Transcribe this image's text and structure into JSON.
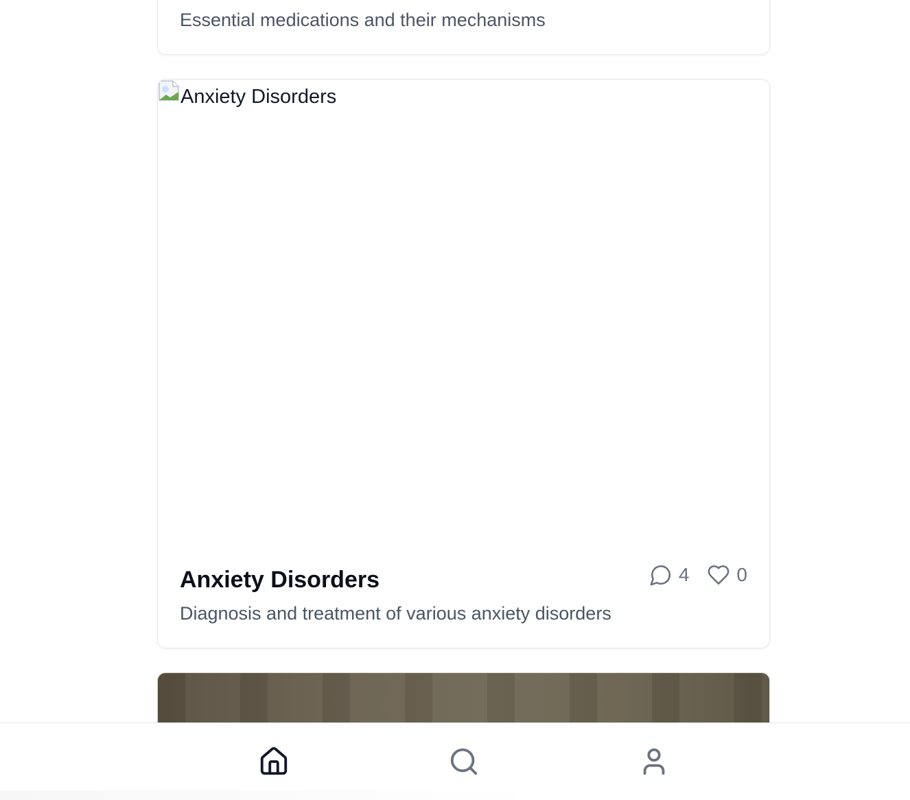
{
  "cards": [
    {
      "description": "Essential medications and their mechanisms"
    },
    {
      "image_alt": "Anxiety Disorders",
      "title": "Anxiety Disorders",
      "description": "Diagnosis and treatment of various anxiety disorders",
      "comments": "4",
      "likes": "0"
    }
  ],
  "icons": {
    "comment": "comment-icon",
    "like": "heart-icon",
    "home": "home-icon",
    "search": "search-icon",
    "profile": "user-icon",
    "broken_image": "broken-image-icon"
  },
  "colors": {
    "text_primary": "#0b0f19",
    "text_secondary": "#4b5563",
    "icon_muted": "#6b7280",
    "nav_active": "#111827",
    "border": "#e5e7eb"
  }
}
